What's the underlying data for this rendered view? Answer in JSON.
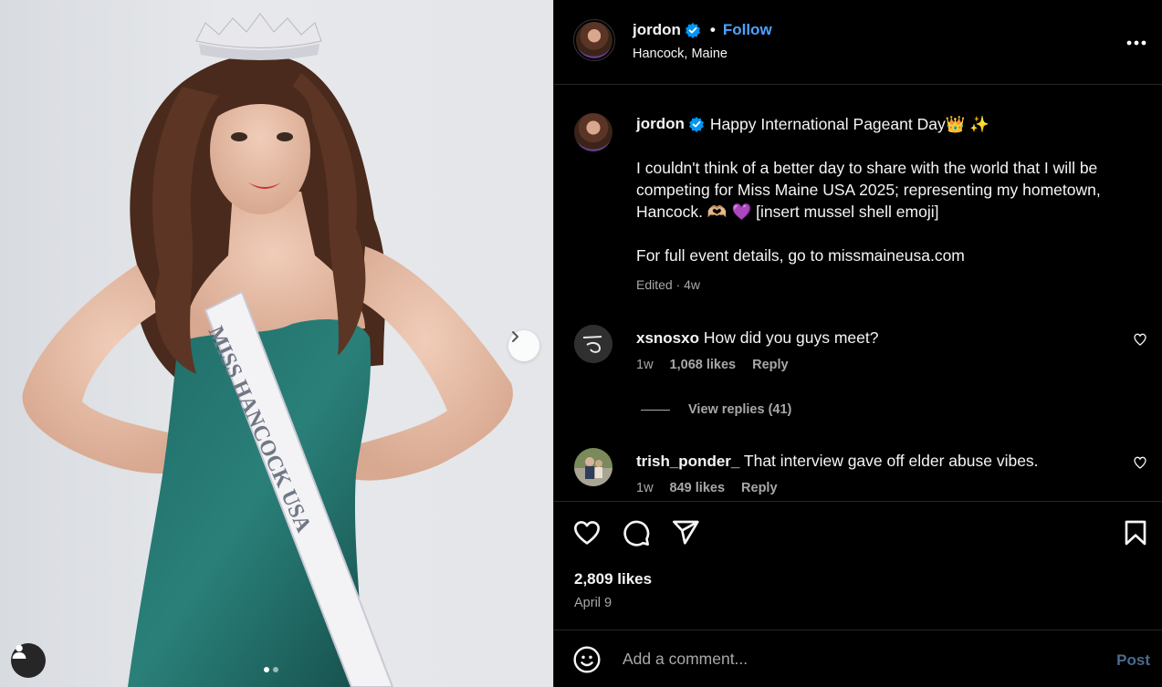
{
  "photo": {
    "sash_text": "MISS HANCOCK USA",
    "carousel": {
      "count": 2,
      "active": 0
    }
  },
  "header": {
    "username": "jordon",
    "follow_label": "Follow",
    "separator": "•",
    "location": "Hancock, Maine",
    "more_icon": "more-horizontal-icon"
  },
  "caption": {
    "username": "jordon",
    "line1": "Happy International Pageant Day👑 ✨",
    "para2": "I couldn't think of a better day to share with the world that I will be competing for Miss Maine USA 2025; representing my hometown, Hancock. 🫶🏼 💜 [insert mussel shell emoji]",
    "para3": "For full event details, go to missmaineusa.com",
    "meta": "Edited · 4w"
  },
  "comments": [
    {
      "username": "xsnosxo",
      "text": "How did you guys meet?",
      "time": "1w",
      "likes": "1,068 likes",
      "reply": "Reply"
    },
    {
      "username": "trish_ponder_",
      "text": "That interview gave off elder abuse vibes.",
      "time": "1w",
      "likes": "849 likes",
      "reply": "Reply"
    }
  ],
  "view_replies": "View replies (41)",
  "actions": {
    "likes": "2,809 likes",
    "date": "April 9"
  },
  "add_comment": {
    "placeholder": "Add a comment...",
    "post_label": "Post"
  },
  "colors": {
    "accent": "#0095f6",
    "follow": "#4da3ff",
    "background": "#000000",
    "muted": "#a8a8a8"
  }
}
